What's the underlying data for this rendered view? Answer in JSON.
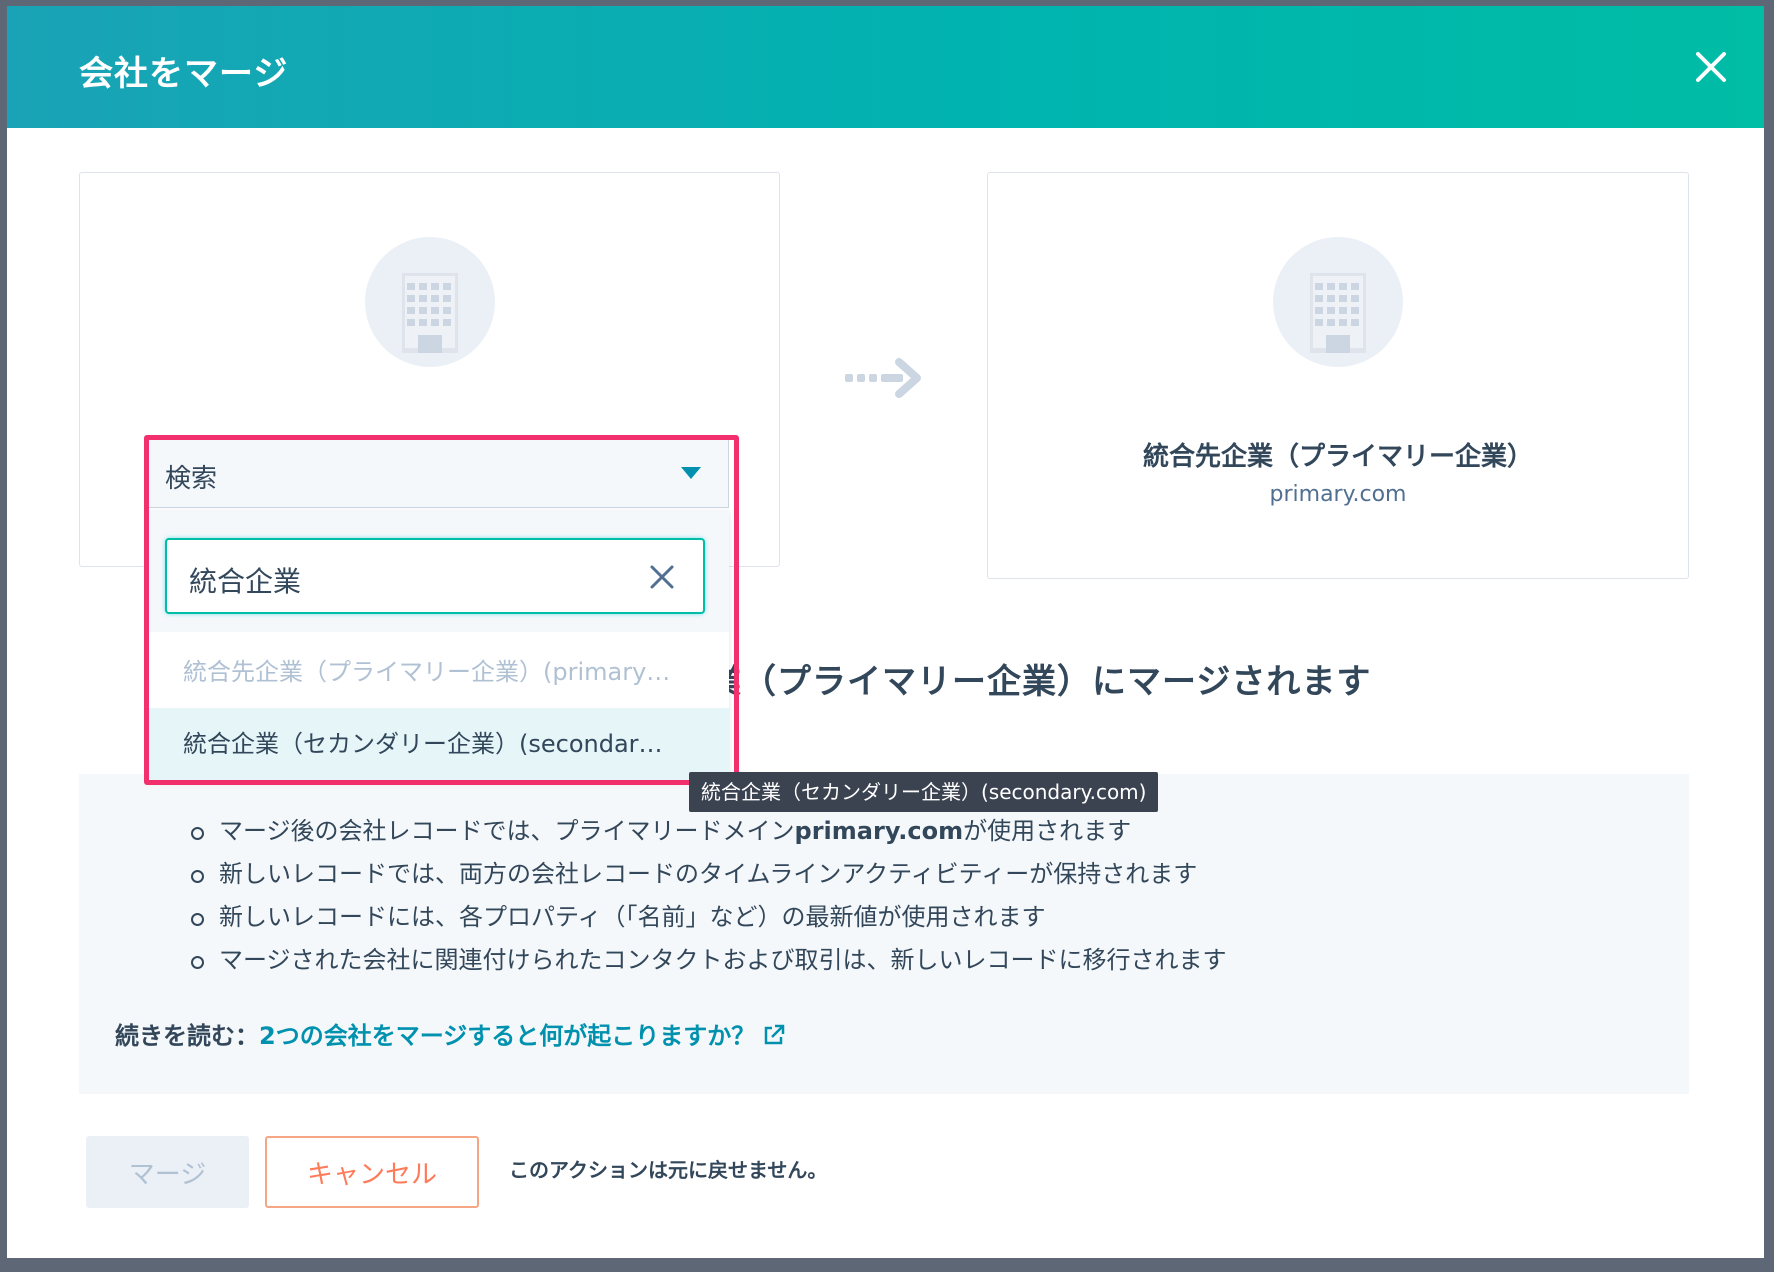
{
  "modal": {
    "title": "会社をマージ"
  },
  "cards": {
    "secondary": {
      "avatar_icon": "building-icon"
    },
    "primary": {
      "avatar_icon": "building-icon",
      "name": "統合先企業（プライマリー企業）",
      "domain": "primary.com"
    }
  },
  "dropdown": {
    "label": "検索",
    "search_value": "統合企業",
    "options": [
      {
        "label": "統合先企業（プライマリー企業）(primary…",
        "disabled": true
      },
      {
        "label": "統合企業（セカンダリー企業）(secondar…",
        "disabled": false
      }
    ],
    "tooltip": "統合企業（セカンダリー企業）(secondary.com)",
    "highlight_color": "#f2306e"
  },
  "merge_sentence": "業（プライマリー企業）にマージされます",
  "info": {
    "bullets": [
      {
        "pre": "マージ後の会社レコードでは、プライマリードメイン",
        "bold": "primary.com",
        "post": "が使用されます"
      },
      {
        "pre": "新しいレコードでは、両方の会社レコードのタイムラインアクティビティーが保持されます",
        "bold": "",
        "post": ""
      },
      {
        "pre": "新しいレコードには、各プロパティ（「名前」など）の最新値が使用されます",
        "bold": "",
        "post": ""
      },
      {
        "pre": "マージされた会社に関連付けられたコンタクトおよび取引は、新しいレコードに移行されます",
        "bold": "",
        "post": ""
      }
    ],
    "read_more_prefix": "続きを読む：",
    "read_more_link": "2つの会社をマージすると何が起こりますか？"
  },
  "footer": {
    "merge_label": "マージ",
    "cancel_label": "キャンセル",
    "note": "このアクションは元に戻せません。"
  },
  "colors": {
    "header_start": "#1aa3b6",
    "header_end": "#00bda5",
    "link": "#0091ae",
    "cancel": "#ff7a59"
  }
}
